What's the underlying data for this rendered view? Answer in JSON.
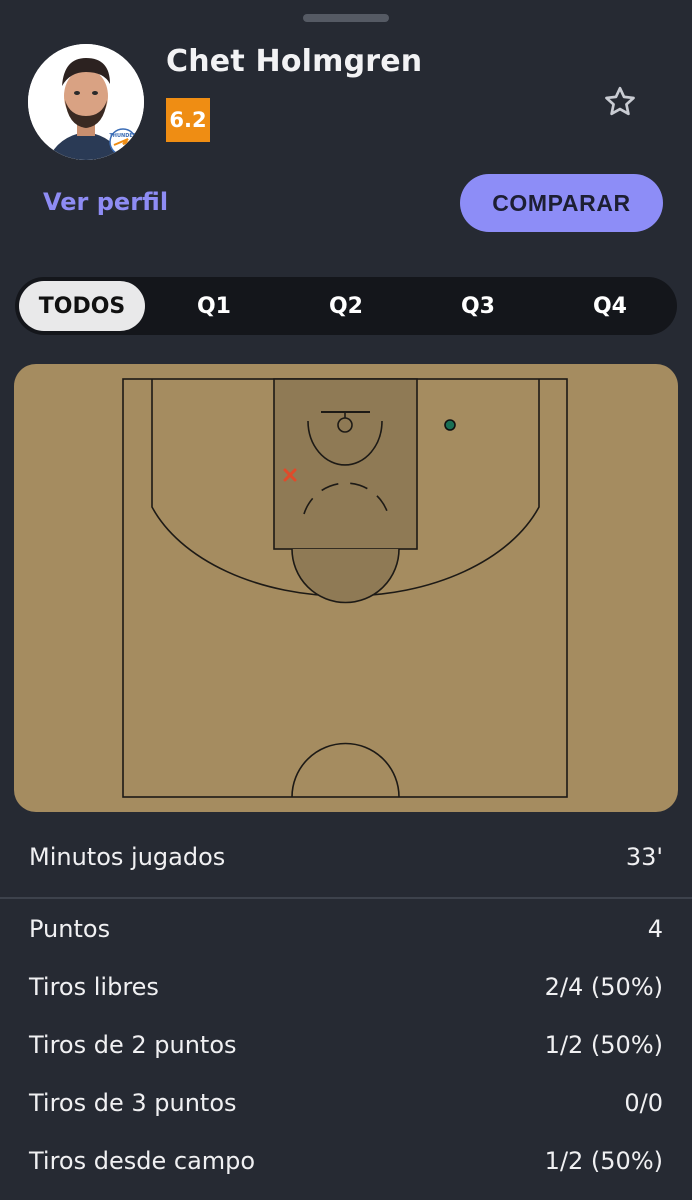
{
  "player": {
    "name": "Chet Holmgren",
    "rating": "6.2",
    "rating_color": "#ef8d13",
    "avatar_icon": "player-photo-icon",
    "team_logo_icon": "thunder-logo-icon",
    "team_logo_text": "THUNDER"
  },
  "actions": {
    "profile_label": "Ver perfil",
    "compare_label": "COMPARAR",
    "favorite_icon": "star-outline-icon"
  },
  "tabs": [
    {
      "label": "TODOS",
      "active": true
    },
    {
      "label": "Q1",
      "active": false
    },
    {
      "label": "Q2",
      "active": false
    },
    {
      "label": "Q3",
      "active": false
    },
    {
      "label": "Q4",
      "active": false
    }
  ],
  "shot_chart": {
    "court_color": "#a58c60",
    "shots": [
      {
        "result": "made",
        "color": "#1a6f55"
      },
      {
        "result": "missed",
        "color": "#e04a2a"
      }
    ]
  },
  "stats": {
    "minutes": {
      "label": "Minutos jugados",
      "value": "33'"
    },
    "rows": [
      {
        "label": "Puntos",
        "value": "4"
      },
      {
        "label": "Tiros libres",
        "value": "2/4 (50%)"
      },
      {
        "label": "Tiros de 2 puntos",
        "value": "1/2 (50%)"
      },
      {
        "label": "Tiros de 3 puntos",
        "value": "0/0"
      },
      {
        "label": "Tiros desde campo",
        "value": "1/2 (50%)"
      }
    ]
  },
  "colors": {
    "background": "#262a33",
    "accent": "#8d8df7",
    "link": "#8e8cf4"
  }
}
